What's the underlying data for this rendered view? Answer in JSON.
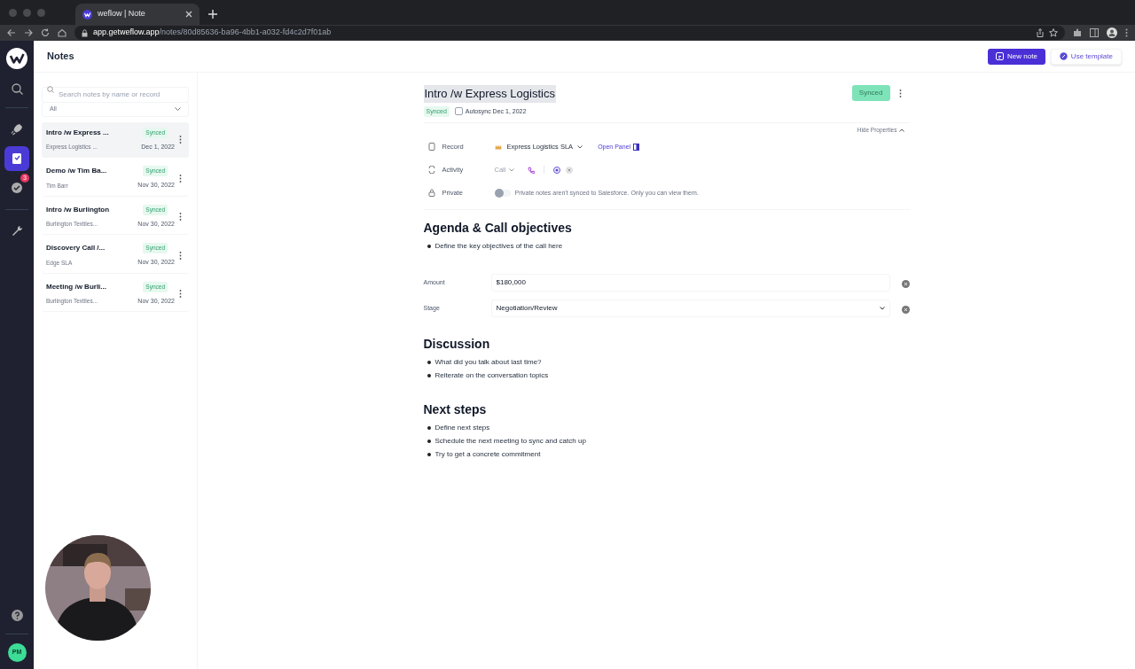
{
  "browser": {
    "tab_title": "weflow | Note",
    "url_host": "app.getweflow.app",
    "url_path": "/notes/80d85636-ba96-4bb1-a032-fd4c2d7f01ab"
  },
  "rail": {
    "items": [
      {
        "kind": "rocket",
        "selected": false
      },
      {
        "kind": "notes",
        "selected": true
      },
      {
        "kind": "tasks",
        "selected": false,
        "badge": "3"
      },
      {
        "kind": "wrench",
        "selected": false
      }
    ],
    "avatar": "PM"
  },
  "header": {
    "title": "Notes",
    "buttons": [
      {
        "label": "New note",
        "kind": "primary"
      },
      {
        "label": "Use template",
        "kind": "secondary"
      }
    ]
  },
  "notes_panel": {
    "search_placeholder": "Search notes by name or record",
    "filter": "All",
    "notes": [
      {
        "title": "Intro /w Express ...",
        "status": "Synced",
        "subtitle": "Express Logistics ...",
        "date": "Dec 1, 2022",
        "selected": true
      },
      {
        "title": "Demo /w Tim Ba...",
        "status": "Synced",
        "subtitle": "Tim Barr",
        "date": "Nov 30, 2022",
        "selected": false
      },
      {
        "title": "Intro /w Burlington",
        "status": "Synced",
        "subtitle": "Burlington Textiles...",
        "date": "Nov 30, 2022",
        "selected": false
      },
      {
        "title": "Discovery Call /...",
        "status": "Synced",
        "subtitle": "Edge SLA",
        "date": "Nov 30, 2022",
        "selected": false
      },
      {
        "title": "Meeting /w Burli...",
        "status": "Synced",
        "subtitle": "Burlington Textiles...",
        "date": "Nov 30, 2022",
        "selected": false
      }
    ]
  },
  "note": {
    "title": "Intro /w Express Logistics",
    "sync_button": "Synced",
    "sync_tag": "Synced",
    "autosync": {
      "label": "Autosync",
      "checked": false
    },
    "date": "Dec 1, 2022",
    "hide_properties": "Hide Properties",
    "properties": [
      {
        "kind": "record",
        "label": "Record",
        "value": "Express Logistics SLA",
        "link": "Open Panel"
      },
      {
        "kind": "activity",
        "label": "Activity",
        "value": "Call"
      },
      {
        "kind": "private",
        "label": "Private",
        "on": false,
        "hint": "Private notes aren't synced to Salesforce. Only you can view them."
      }
    ],
    "blocks": [
      {
        "kind": "heading",
        "text": "Agenda & Call objectives"
      },
      {
        "kind": "bullet",
        "text": "Define the key objectives of the call here"
      },
      {
        "kind": "input",
        "label": "Amount",
        "value": "$180,000"
      },
      {
        "kind": "select",
        "label": "Stage",
        "value": "Negotiation/Review"
      },
      {
        "kind": "heading",
        "text": "Discussion"
      },
      {
        "kind": "bullet",
        "text": "What did you talk about last time?"
      },
      {
        "kind": "bullet",
        "text": "Reiterate on the conversation topics"
      },
      {
        "kind": "heading",
        "text": "Next steps"
      },
      {
        "kind": "bullet",
        "text": "Define next steps"
      },
      {
        "kind": "bullet",
        "text": "Schedule the next meeting to sync and catch up"
      },
      {
        "kind": "bullet",
        "text": "Try to get a concrete commitment"
      }
    ]
  }
}
